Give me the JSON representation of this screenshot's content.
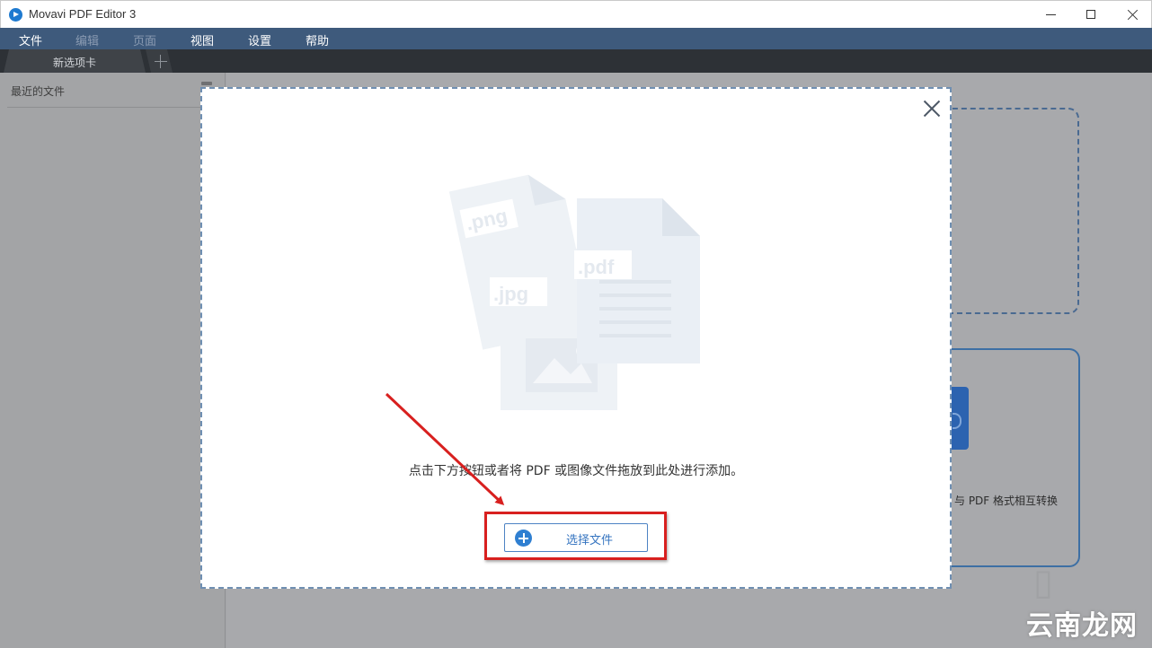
{
  "window": {
    "title": "Movavi PDF Editor 3",
    "controls": [
      "minimize",
      "maximize",
      "close"
    ]
  },
  "menu": {
    "items": [
      {
        "label": "文件",
        "enabled": true
      },
      {
        "label": "编辑",
        "enabled": false
      },
      {
        "label": "页面",
        "enabled": false
      },
      {
        "label": "视图",
        "enabled": true
      },
      {
        "label": "设置",
        "enabled": true
      },
      {
        "label": "帮助",
        "enabled": true
      }
    ]
  },
  "tabs": {
    "items": [
      {
        "label": "新选项卡"
      }
    ],
    "add_tab": "plus-icon"
  },
  "sidebar": {
    "title": "最近的文件"
  },
  "background": {
    "convert_text": "与 PDF 格式相互转换"
  },
  "dialog": {
    "file_types": [
      ".png",
      ".jpg",
      ".pdf"
    ],
    "instruction": "点击下方按钮或者将 PDF 或图像文件拖放到此处进行添加。",
    "select_button_label": "选择文件",
    "select_button_icon": "plus-circle-icon"
  },
  "watermark": {
    "text": "云南龙网"
  },
  "colors": {
    "menu_bg": "#3e5a7c",
    "accent": "#2f7fd1",
    "highlight": "#d8201f"
  }
}
